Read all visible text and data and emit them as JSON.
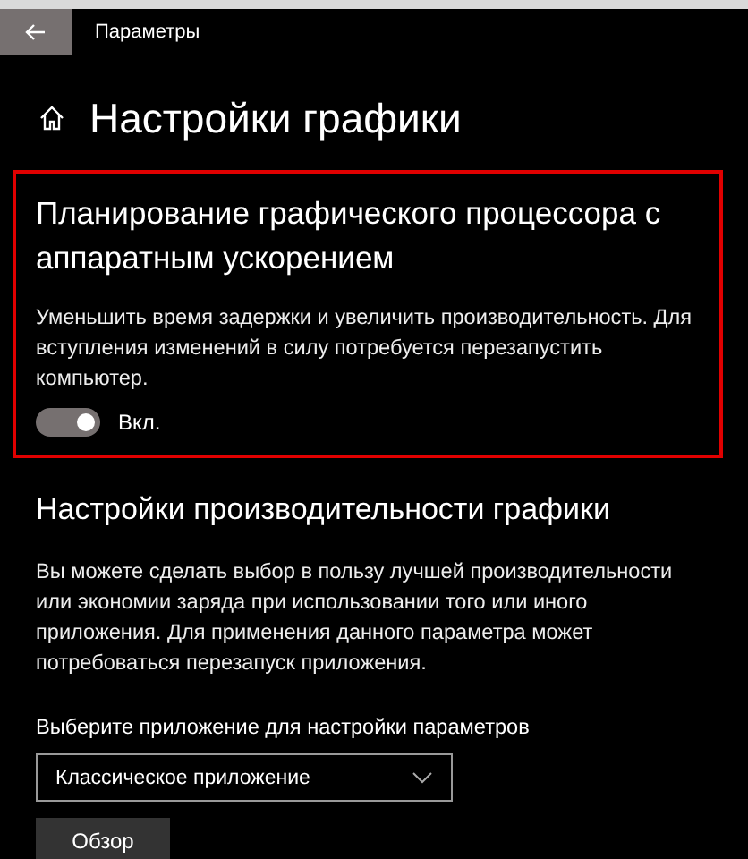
{
  "window": {
    "title": "Параметры"
  },
  "page": {
    "title": "Настройки графики"
  },
  "gpu_scheduling": {
    "title": "Планирование графического процессора с аппаратным ускорением",
    "description": "Уменьшить время задержки и увеличить производительность. Для вступления изменений в силу потребуется перезапустить компьютер.",
    "toggle": {
      "on": true,
      "label": "Вкл."
    }
  },
  "performance": {
    "title": "Настройки производительности графики",
    "description": "Вы можете сделать выбор в пользу лучшей производительности или экономии заряда при использовании того или иного приложения. Для применения данного параметра может потребоваться перезапуск приложения.",
    "select_label": "Выберите приложение для настройки параметров",
    "select_value": "Классическое приложение",
    "browse_button": "Обзор"
  }
}
